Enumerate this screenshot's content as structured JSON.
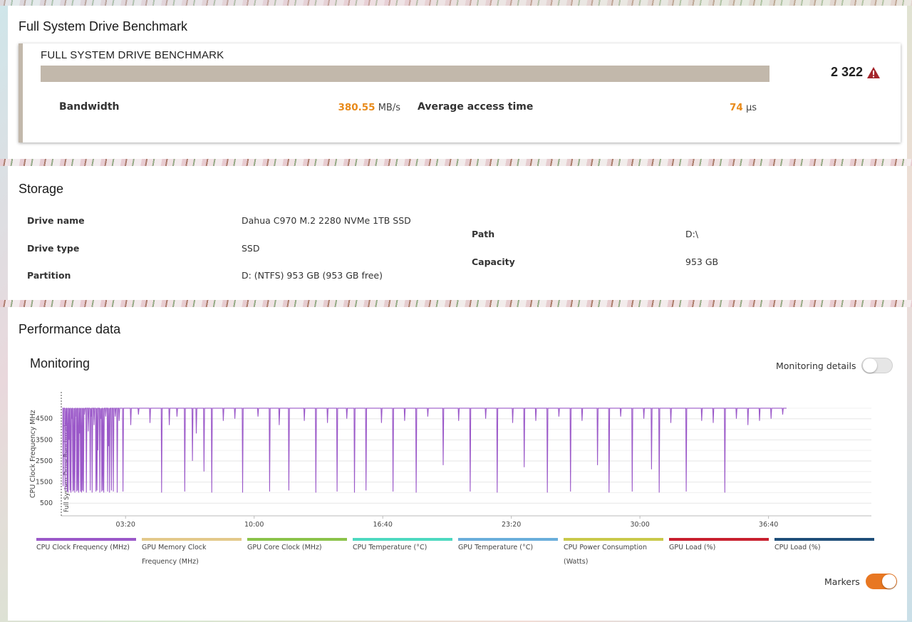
{
  "benchmark_panel": {
    "title": "Full System Drive Benchmark",
    "card_title": "FULL SYSTEM DRIVE BENCHMARK",
    "score": "2 322",
    "warning_icon": "warning-triangle-icon",
    "bandwidth_label": "Bandwidth",
    "bandwidth_value": "380.55",
    "bandwidth_unit": "MB/s",
    "access_label": "Average access time",
    "access_value": "74",
    "access_unit": "μs",
    "accent_color": "#c2b8ab",
    "value_color": "#e88a1a"
  },
  "storage": {
    "title": "Storage",
    "drive_name_label": "Drive name",
    "drive_name": "Dahua C970 M.2 2280 NVMe 1TB SSD",
    "drive_type_label": "Drive type",
    "drive_type": "SSD",
    "partition_label": "Partition",
    "partition": "D: (NTFS) 953 GB (953 GB free)",
    "path_label": "Path",
    "path": "D:\\",
    "capacity_label": "Capacity",
    "capacity": "953 GB"
  },
  "performance": {
    "title": "Performance data",
    "monitoring_title": "Monitoring",
    "monitoring_details_label": "Monitoring details",
    "monitoring_details_on": false,
    "markers_label": "Markers",
    "markers_on": true,
    "legend": [
      {
        "label": "CPU Clock Frequency (MHz)",
        "color": "#9b59c9"
      },
      {
        "label": "GPU Memory Clock Frequency (MHz)",
        "color": "#e3c98a"
      },
      {
        "label": "GPU Core Clock (MHz)",
        "color": "#8bc34a"
      },
      {
        "label": "CPU Temperature (°C)",
        "color": "#4dd9c0"
      },
      {
        "label": "GPU Temperature (°C)",
        "color": "#6aaedb"
      },
      {
        "label": "CPU Power Consumption (Watts)",
        "color": "#c9c94a"
      },
      {
        "label": "GPU Load (%)",
        "color": "#c8202f"
      },
      {
        "label": "CPU Load (%)",
        "color": "#1f4e79"
      }
    ]
  },
  "chart_data": {
    "type": "line",
    "ylabel": "CPU Clock Frequency MHz",
    "marker_label": "Full System Drive Benchmark",
    "y_ticks": [
      500,
      1500,
      2500,
      3500,
      4500
    ],
    "x_ticks": [
      "03:20",
      "10:00",
      "16:40",
      "23:20",
      "30:00",
      "36:40"
    ],
    "ylim": [
      0,
      5300
    ],
    "grid": true,
    "series": [
      {
        "name": "CPU Clock Frequency (MHz)",
        "color": "#9b59c9",
        "baseline": 5000,
        "dips_min": [
          0.1,
          0.2,
          0.25,
          0.3,
          0.35,
          0.4,
          0.45,
          0.5,
          0.55,
          0.6,
          0.65,
          0.7,
          0.75,
          0.8,
          0.85,
          0.9,
          0.95,
          1.0,
          1.05,
          1.1,
          1.15,
          1.2,
          1.3,
          1.4,
          1.5,
          1.55,
          1.6,
          1.7,
          1.8,
          1.85,
          1.9,
          2.0,
          2.05,
          2.1,
          2.15,
          2.2,
          2.3,
          2.4,
          2.45,
          2.5,
          2.6,
          2.7,
          2.8,
          2.9,
          3.0,
          3.2,
          3.6,
          4.0,
          4.6,
          5.2,
          5.6,
          6.0,
          6.4,
          6.8,
          7.0,
          7.4,
          7.8,
          8.4,
          9.0,
          9.4,
          10.2,
          10.8,
          11.3,
          11.8,
          12.6,
          13.2,
          13.8,
          14.3,
          14.8,
          15.2,
          15.8,
          16.6,
          17.2,
          17.8,
          18.4,
          19.0,
          19.8,
          20.6,
          21.2,
          22.0,
          22.6,
          23.4,
          24.0,
          24.6,
          25.2,
          25.8,
          26.4,
          27.0,
          27.8,
          28.4,
          29.0,
          29.6,
          30.2,
          30.6,
          31.0,
          31.6,
          32.4,
          33.2,
          33.8,
          34.4,
          35.0,
          35.6,
          36.2,
          36.8,
          37.4
        ],
        "dips_val": [
          1300,
          1100,
          4200,
          1050,
          1000,
          3500,
          1100,
          1000,
          4500,
          1050,
          1100,
          1000,
          4600,
          1050,
          1100,
          1000,
          3800,
          1050,
          1000,
          1100,
          1050,
          4700,
          1000,
          3900,
          1100,
          4600,
          1000,
          4200,
          1050,
          1100,
          3000,
          1000,
          4500,
          1050,
          1100,
          1000,
          4600,
          1050,
          3200,
          1000,
          1100,
          1050,
          4600,
          1000,
          4400,
          1050,
          4200,
          4700,
          4300,
          1000,
          4200,
          4600,
          1050,
          2500,
          3800,
          2000,
          1000,
          4400,
          4500,
          1000,
          4600,
          1050,
          4200,
          1100,
          4400,
          1000,
          4300,
          1050,
          4500,
          1000,
          1100,
          4300,
          1050,
          4400,
          1000,
          4600,
          2300,
          4400,
          1050,
          4500,
          1000,
          4300,
          2200,
          4400,
          1000,
          4600,
          1050,
          4400,
          2300,
          1000,
          4600,
          1050,
          4500,
          2100,
          1000,
          4300,
          1050,
          4400,
          4300,
          1000,
          4500,
          4200,
          4400,
          4500,
          4700
        ]
      }
    ]
  }
}
